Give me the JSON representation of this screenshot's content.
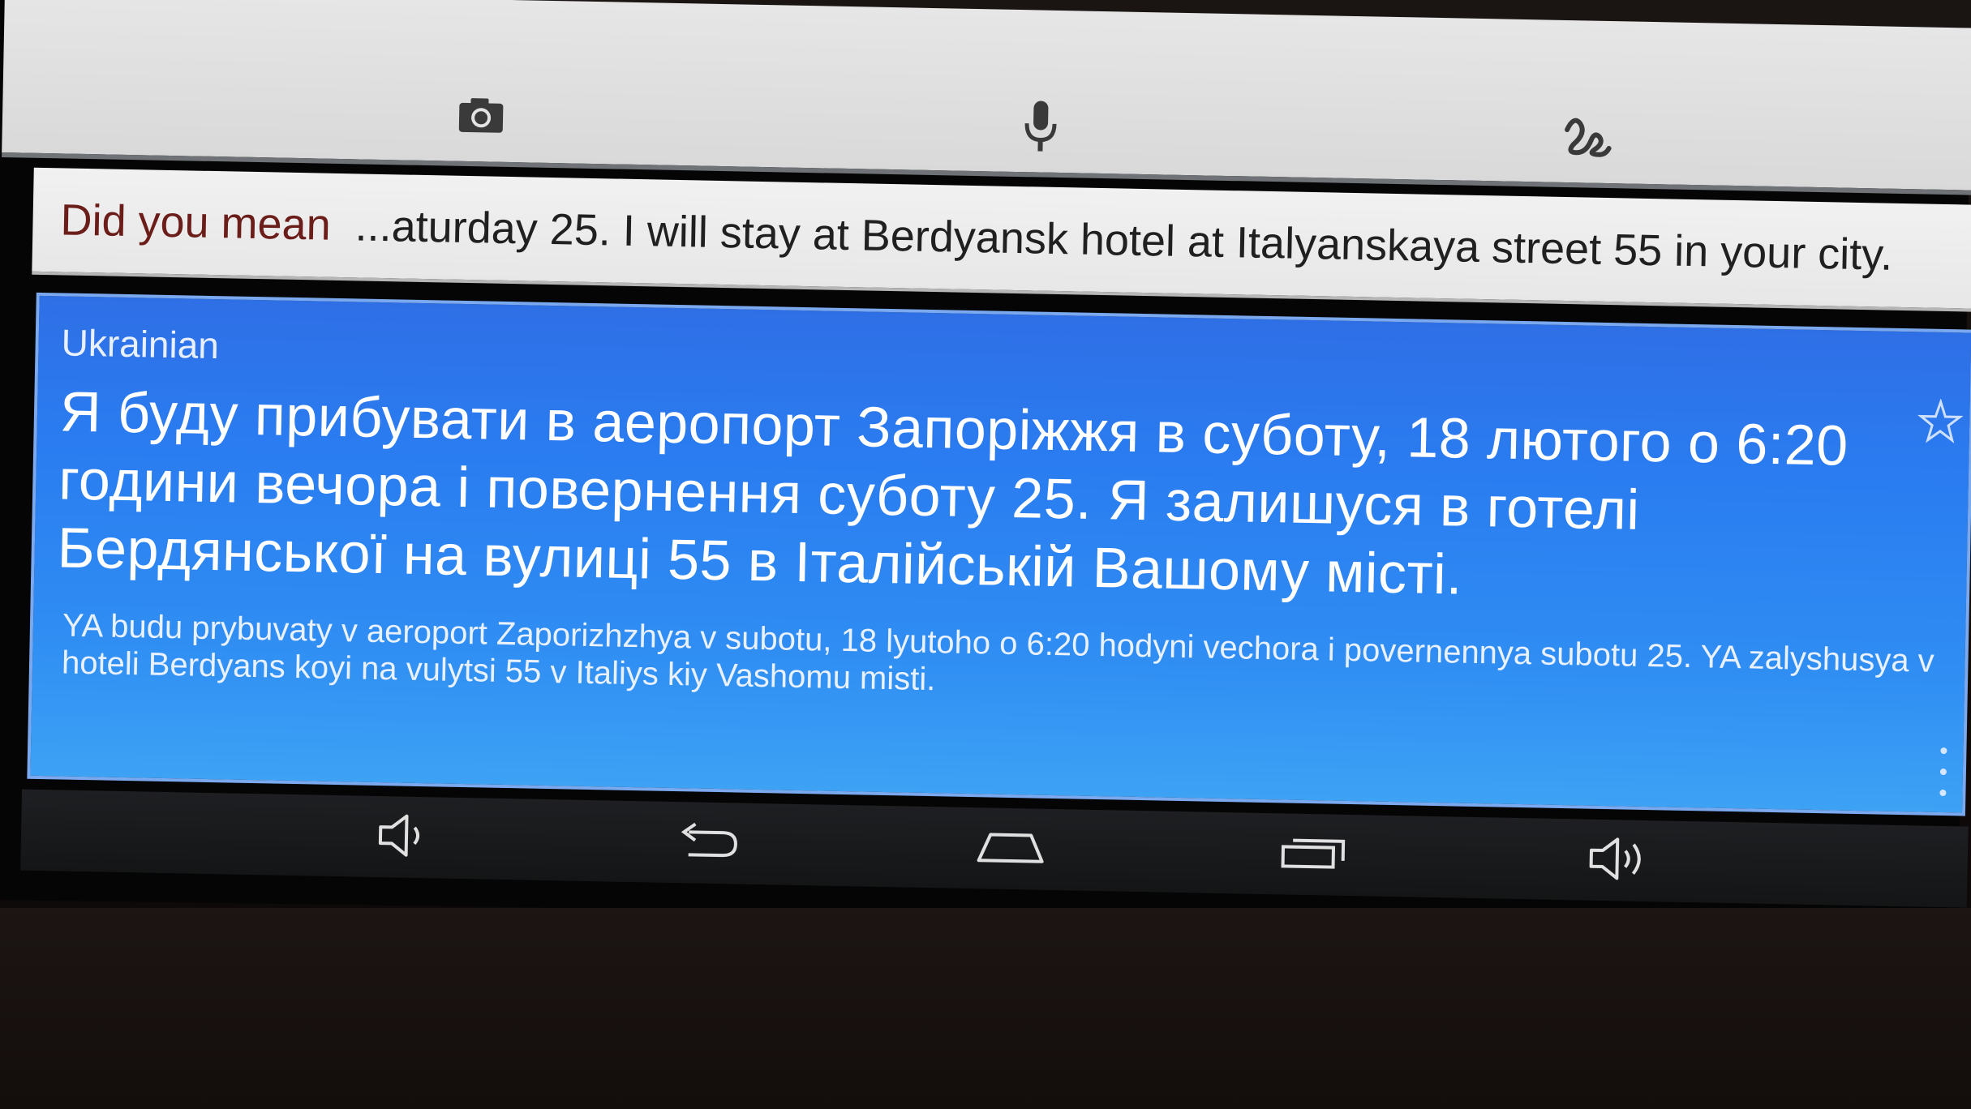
{
  "toolbar": {
    "icons": [
      "camera-icon",
      "microphone-icon",
      "handwriting-icon"
    ]
  },
  "suggestion": {
    "label": "Did you mean",
    "text": "...aturday 25. I will stay at Berdyansk hotel at Italyanskaya street 55 in your city."
  },
  "result": {
    "language": "Ukrainian",
    "translation": "Я буду прибувати в аеропорт Запоріжжя в суботу, 18 лютого о 6:20 години вечора і повернення суботу 25. Я залишуся в готелі Бердянської на вулиці 55 в Італійській Вашому місті.",
    "transliteration": "YA budu prybuvaty v aeroport Zaporizhzhya v subotu, 18 lyutoho o 6:20 hodyni vechora i povernennya subotu 25. YA zalyshusya v hoteli Berdyans koyi na vulytsi 55 v Italiys kiy Vashomu misti."
  },
  "navbar": {
    "buttons": [
      "volume-down-icon",
      "back-icon",
      "home-icon",
      "recents-icon",
      "volume-up-icon"
    ]
  },
  "colors": {
    "card_blue": "#2f7ff0",
    "suggestion_label": "#6b1d1a",
    "navbar": "#1a1b1d"
  }
}
